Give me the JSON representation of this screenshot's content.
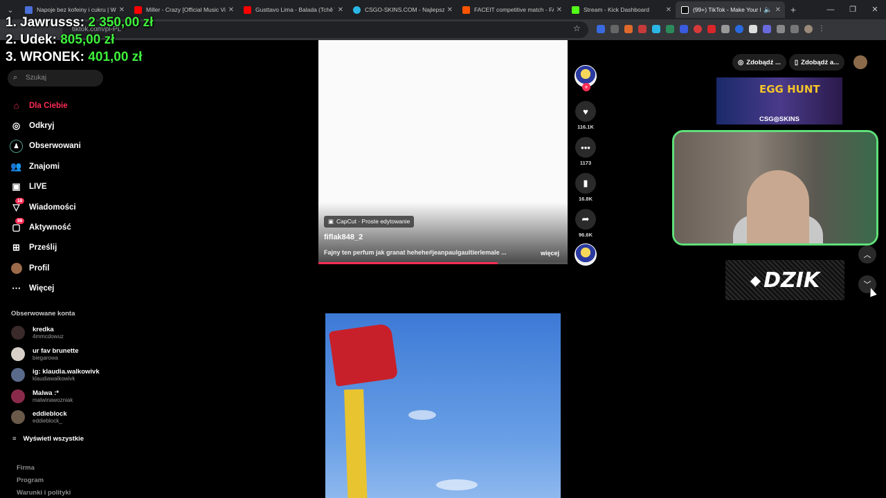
{
  "browser": {
    "tabs": [
      {
        "title": "Napoje bez kofeiny i cukru | W",
        "color": "#4a6fd8"
      },
      {
        "title": "Miller - Crazy [Official Music Vi",
        "color": "#ff0000"
      },
      {
        "title": "Gusttavo Lima - Balada (Tchê Tc",
        "color": "#ff0000"
      },
      {
        "title": "CSGO-SKINS.COM - Najlepsze",
        "color": "#2ab7e6"
      },
      {
        "title": "FACEIT competitive match - FA",
        "color": "#ff5500"
      },
      {
        "title": "Stream - Kick Dashboard",
        "color": "#53fc18"
      },
      {
        "title": "(99+) TikTok - Make Your D",
        "color": "#ffffff"
      }
    ],
    "url": "tiktok.com/pl-PL"
  },
  "overlay": {
    "lines": [
      {
        "label": "1. Jawrusss:",
        "value": "2 350,00 zł"
      },
      {
        "label": "2. Udek:",
        "value": "805,00 zł"
      },
      {
        "label": "3. WRONEK:",
        "value": "401,00 zł"
      }
    ]
  },
  "sidebar": {
    "search_placeholder": "Szukaj",
    "nav": [
      {
        "label": "Dla Ciebie",
        "icon": "home-icon"
      },
      {
        "label": "Odkryj",
        "icon": "compass-icon"
      },
      {
        "label": "Obserwowani",
        "icon": "following-icon"
      },
      {
        "label": "Znajomi",
        "icon": "friends-icon"
      },
      {
        "label": "LIVE",
        "icon": "live-icon"
      },
      {
        "label": "Wiadomości",
        "icon": "messages-icon",
        "badge": "18"
      },
      {
        "label": "Aktywność",
        "icon": "activity-icon",
        "badge": "98"
      },
      {
        "label": "Prześlij",
        "icon": "upload-icon"
      },
      {
        "label": "Profil",
        "icon": "profile-icon"
      },
      {
        "label": "Więcej",
        "icon": "more-icon"
      }
    ],
    "following_title": "Obserwowane konta",
    "accounts": [
      {
        "name": "kredka",
        "user": "4mmcdowuz"
      },
      {
        "name": "ur fav brunette",
        "user": "biegarowa"
      },
      {
        "name": "ig: klaudia.walkowivk",
        "user": "klaudiawalkowivk"
      },
      {
        "name": "Malwa :*",
        "user": "malwinawozniak"
      },
      {
        "name": "eddieblock",
        "user": "eddieblock_"
      }
    ],
    "show_all": "Wyświetl wszystkie",
    "footer": [
      "Firma",
      "Program",
      "Warunki i polityki"
    ]
  },
  "video": {
    "capcut_label": "CapCut · Proste edytowanie",
    "author": "fiflak848_2",
    "description": "Fajny ten perfum jak granat hehehe#jeanpaulgaultierlemale ...",
    "more": "więcej",
    "progress": 0.72,
    "actions": {
      "likes": "116.1K",
      "comments": "1173",
      "saves": "16.8K",
      "shares": "96.6K"
    }
  },
  "right": {
    "buttons": [
      "Zdobądź ...",
      "Zdobądź a..."
    ],
    "egg_title": "EGG HUNT",
    "egg_brand": "CSG◎SKINS",
    "dzik": "DZIK"
  }
}
